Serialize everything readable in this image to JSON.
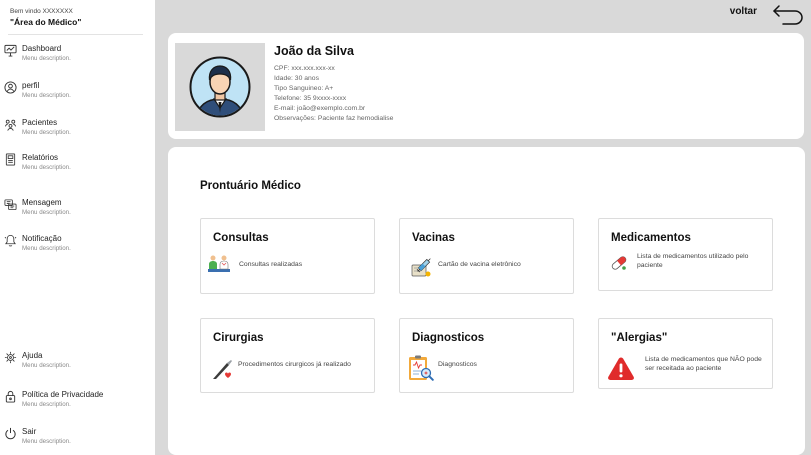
{
  "sidebar": {
    "welcome": "Bem vindo XXXXXXX",
    "area_title": "\"Área do Médico\"",
    "items": [
      {
        "label": "Dashboard",
        "description": "Menu description."
      },
      {
        "label": "perfil",
        "description": "Menu description."
      },
      {
        "label": "Pacientes",
        "description": "Menu description."
      },
      {
        "label": "Relatórios",
        "description": "Menu description."
      },
      {
        "label": "Mensagem",
        "description": "Menu description."
      },
      {
        "label": "Notificação",
        "description": "Menu description."
      },
      {
        "label": "Ajuda",
        "description": "Menu description."
      },
      {
        "label": "Política de Privacidade",
        "description": "Menu description."
      },
      {
        "label": "Sair",
        "description": "Menu description."
      }
    ]
  },
  "header": {
    "back_label": "voltar"
  },
  "patient": {
    "name": "João da Silva",
    "cpf": "CPF: xxx.xxx.xxx-xx",
    "idade": "Idade: 30 anos",
    "tipo_sanguineo": "Tipo Sanguineo: A+",
    "telefone": "Telefone: 35 9xxxx-xxxx",
    "email": "E-mail: joão@exemplo.com.br",
    "observacoes": "Observações: Paciente faz hemodialise"
  },
  "records": {
    "title": "Prontuário Médico",
    "cards": [
      {
        "title": "Consultas",
        "description": "Consultas  realizadas"
      },
      {
        "title": "Vacinas",
        "description": "Cartão de vacina eletrônico"
      },
      {
        "title": "Medicamentos",
        "description": "Lista de medicamentos utilizado pelo paciente"
      },
      {
        "title": "Cirurgias",
        "description": "Procedimentos cirurgicos já realizado"
      },
      {
        "title": "Diagnosticos",
        "description": "Diagnosticos"
      },
      {
        "title": "\"Alergias\"",
        "description": "Lista de medicamentos que NÃO pode ser receitada ao paciente"
      }
    ]
  },
  "icons": {
    "sidebar": [
      "dashboard-icon",
      "profile-icon",
      "patients-icon",
      "reports-icon",
      "message-icon",
      "notification-icon",
      "help-icon",
      "privacy-lock-icon",
      "power-icon"
    ],
    "cards": [
      "doctor-consultation-icon",
      "vaccine-syringe-icon",
      "medicine-capsule-icon",
      "surgery-scalpel-icon",
      "diagnosis-clipboard-icon",
      "allergy-warning-icon"
    ]
  },
  "colors": {
    "background": "#d9d9d9",
    "panel": "#ffffff",
    "alert_red": "#e02b2b",
    "avatar_blue": "#2f4e7a"
  }
}
